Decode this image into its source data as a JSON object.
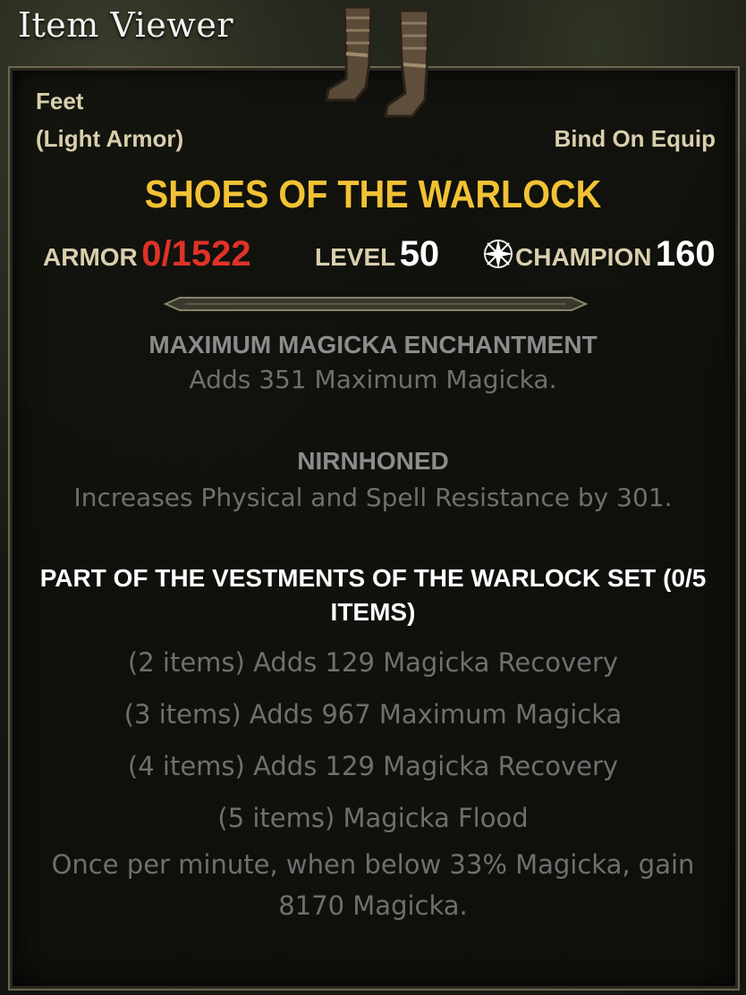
{
  "window": {
    "title": "Item Viewer"
  },
  "item": {
    "slot": "Feet",
    "armor_type": "(Light Armor)",
    "bind": "Bind On Equip",
    "name": "SHOES OF THE WARLOCK",
    "icon": "boots-icon"
  },
  "stats": {
    "armor_label": "ARMOR",
    "armor_value": "0/1522",
    "level_label": "LEVEL",
    "level_value": "50",
    "champion_label": "CHAMPION",
    "champion_value": "160",
    "champion_icon": "champion-star-icon"
  },
  "enchantment": {
    "title": "MAXIMUM MAGICKA ENCHANTMENT",
    "desc": "Adds 351 Maximum Magicka."
  },
  "trait": {
    "title": "NIRNHONED",
    "desc": "Increases Physical and Spell Resistance by 301."
  },
  "set": {
    "title_line1": "PART OF THE VESTMENTS OF THE WARLOCK SET (0/5",
    "title_line2": "ITEMS)",
    "bonuses": [
      "(2 items) Adds 129 Magicka Recovery",
      "(3 items) Adds 967 Maximum Magicka",
      "(4 items) Adds 129 Magicka Recovery",
      "(5 items) Magicka Flood"
    ],
    "flood_line1": "Once per minute, when below 33% Magicka, gain",
    "flood_line2": "8170 Magicka."
  },
  "colors": {
    "item_name": "#f2c234",
    "armor_value": "#e03228",
    "label": "#d9cfae"
  }
}
